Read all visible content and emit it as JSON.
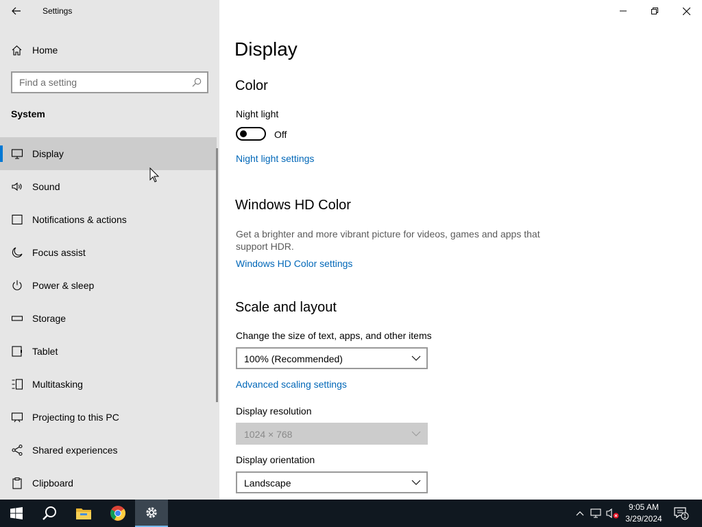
{
  "window": {
    "title": "Settings"
  },
  "sidebar": {
    "home_label": "Home",
    "search_placeholder": "Find a setting",
    "section": "System",
    "items": [
      {
        "label": "Display",
        "icon": "monitor-icon",
        "active": true
      },
      {
        "label": "Sound",
        "icon": "speaker-icon"
      },
      {
        "label": "Notifications & actions",
        "icon": "notification-icon"
      },
      {
        "label": "Focus assist",
        "icon": "moon-icon"
      },
      {
        "label": "Power & sleep",
        "icon": "power-icon"
      },
      {
        "label": "Storage",
        "icon": "storage-icon"
      },
      {
        "label": "Tablet",
        "icon": "tablet-icon"
      },
      {
        "label": "Multitasking",
        "icon": "multitasking-icon"
      },
      {
        "label": "Projecting to this PC",
        "icon": "projector-icon"
      },
      {
        "label": "Shared experiences",
        "icon": "share-icon"
      },
      {
        "label": "Clipboard",
        "icon": "clipboard-icon"
      }
    ]
  },
  "main": {
    "title": "Display",
    "color": {
      "heading": "Color",
      "night_light_label": "Night light",
      "night_light_state": "Off",
      "night_light_link": "Night light settings"
    },
    "hd_color": {
      "heading": "Windows HD Color",
      "description": "Get a brighter and more vibrant picture for videos, games and apps that support HDR.",
      "link": "Windows HD Color settings"
    },
    "scale_layout": {
      "heading": "Scale and layout",
      "scale_label": "Change the size of text, apps, and other items",
      "scale_value": "100% (Recommended)",
      "advanced_link": "Advanced scaling settings",
      "resolution_label": "Display resolution",
      "resolution_value": "1024 × 768",
      "orientation_label": "Display orientation",
      "orientation_value": "Landscape"
    }
  },
  "taskbar": {
    "time": "9:05 AM",
    "date": "3/29/2024",
    "notification_count": "1"
  },
  "colors": {
    "accent": "#0078d4",
    "link": "#0067b8",
    "sidebar_bg": "#e6e6e6",
    "taskbar_bg": "#101820"
  }
}
